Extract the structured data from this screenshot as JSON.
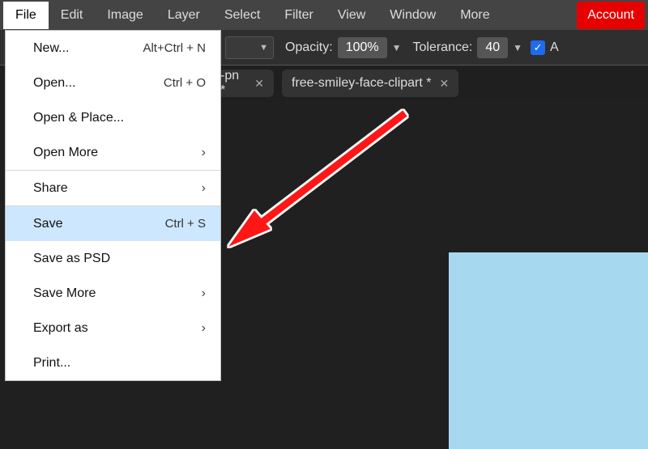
{
  "menubar": {
    "items": [
      "File",
      "Edit",
      "Image",
      "Layer",
      "Select",
      "Filter",
      "View",
      "Window",
      "More"
    ],
    "account": "Account"
  },
  "options": {
    "opacity_label": "Opacity:",
    "opacity_value": "100%",
    "tolerance_label": "Tolerance:",
    "tolerance_value": "40",
    "clip_a": "A"
  },
  "tabs": {
    "t0_label": "-pn *",
    "t1_label": "free-smiley-face-clipart *"
  },
  "filemenu": {
    "new_label": "New...",
    "new_shortcut": "Alt+Ctrl + N",
    "open_label": "Open...",
    "open_shortcut": "Ctrl + O",
    "openplace_label": "Open & Place...",
    "openmore_label": "Open More",
    "share_label": "Share",
    "save_label": "Save",
    "save_shortcut": "Ctrl + S",
    "savepsd_label": "Save as PSD",
    "savemore_label": "Save More",
    "export_label": "Export as",
    "print_label": "Print..."
  }
}
